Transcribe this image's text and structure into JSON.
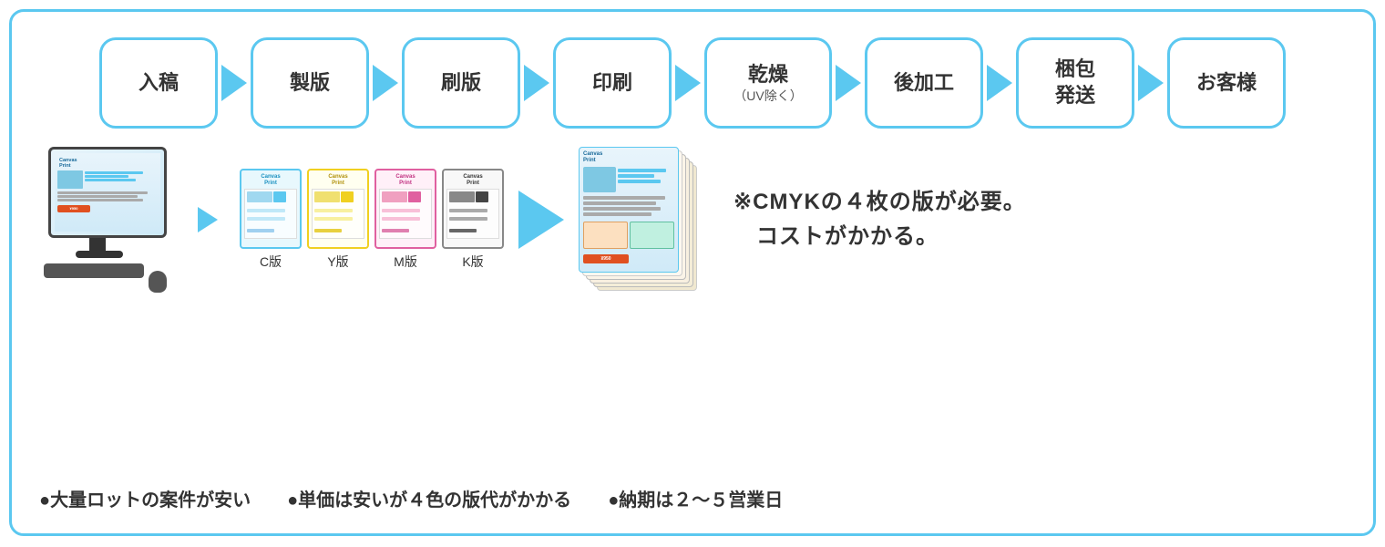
{
  "flow": {
    "steps": [
      {
        "id": "nyukou",
        "label": "入稿",
        "sub": ""
      },
      {
        "id": "seihan",
        "label": "製版",
        "sub": ""
      },
      {
        "id": "satsuban",
        "label": "刷版",
        "sub": ""
      },
      {
        "id": "insatsu",
        "label": "印刷",
        "sub": ""
      },
      {
        "id": "kanso",
        "label": "乾燥",
        "sub": "（UV除く）"
      },
      {
        "id": "koka",
        "label": "後加工",
        "sub": ""
      },
      {
        "id": "konpo",
        "label": "梱包\n発送",
        "sub": ""
      },
      {
        "id": "okyaku",
        "label": "お客様",
        "sub": ""
      }
    ]
  },
  "plates": {
    "items": [
      {
        "id": "c",
        "label": "C版"
      },
      {
        "id": "y",
        "label": "Y版"
      },
      {
        "id": "m",
        "label": "M版"
      },
      {
        "id": "k",
        "label": "K版"
      }
    ]
  },
  "note": {
    "line1": "※CMYKの４枚の版が必要。",
    "line2": "　コストがかかる。"
  },
  "bullets": [
    {
      "text": "●大量ロットの案件が安い"
    },
    {
      "text": "●単価は安いが４色の版代がかかる"
    },
    {
      "text": "●納期は２〜５営業日"
    }
  ],
  "colors": {
    "blue": "#5bc8f0",
    "dark": "#333"
  }
}
